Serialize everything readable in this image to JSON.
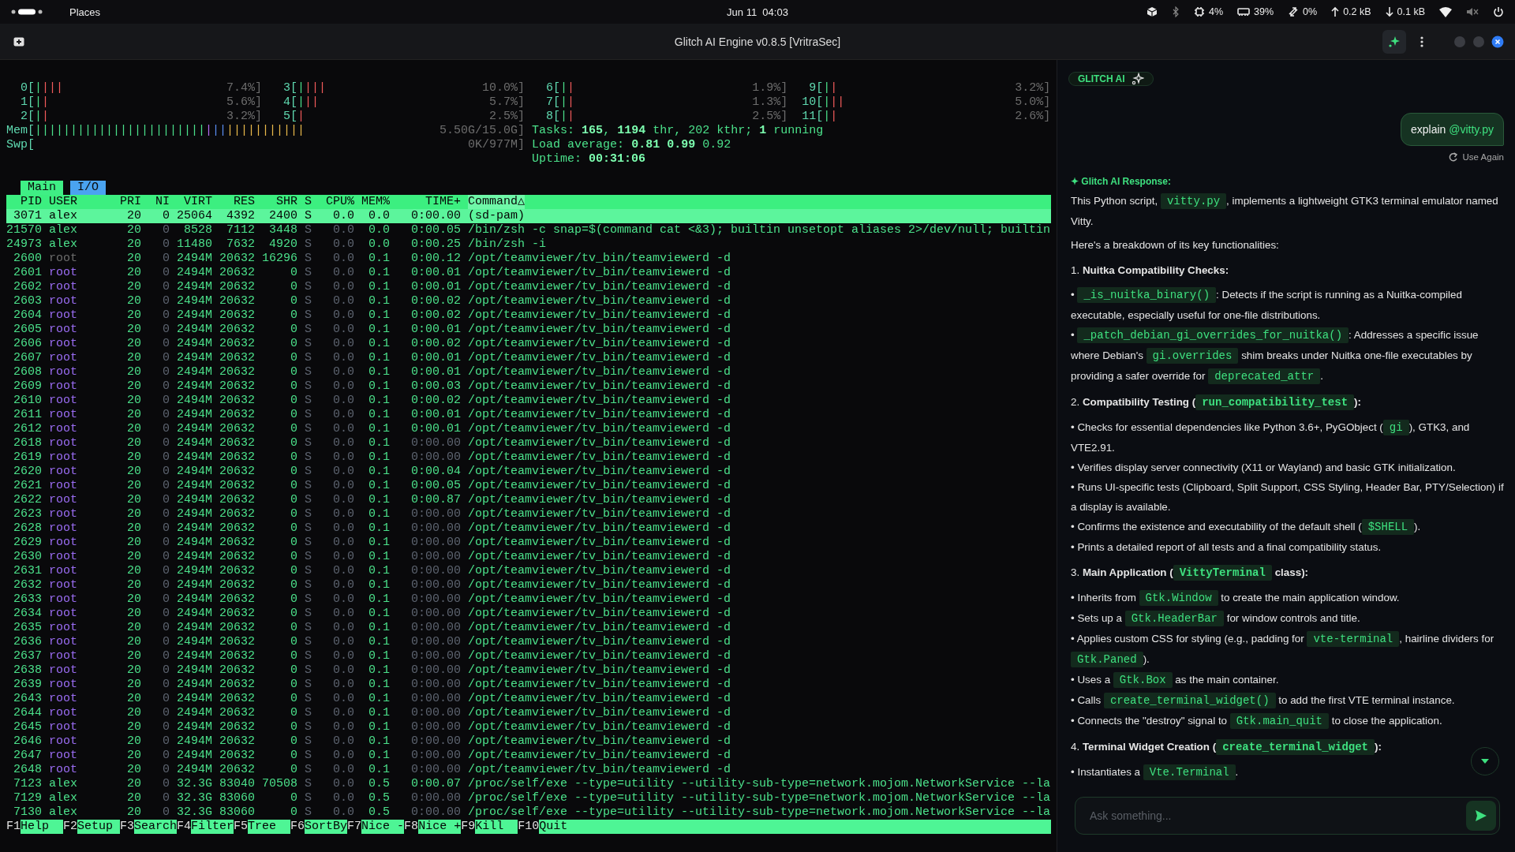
{
  "top_bar": {
    "places": "Places",
    "clock": "Jun 11  04:03",
    "indicators": [
      {
        "kind": "package"
      },
      {
        "kind": "bluetooth"
      },
      {
        "kind": "cpu",
        "text": "4%"
      },
      {
        "kind": "memory",
        "text": "39%"
      },
      {
        "kind": "transfer",
        "text": "0%"
      },
      {
        "kind": "upload",
        "text": "0.2 kB"
      },
      {
        "kind": "download",
        "text": "0.1 kB"
      },
      {
        "kind": "wifi"
      },
      {
        "kind": "muted"
      },
      {
        "kind": "power"
      }
    ]
  },
  "window": {
    "title": "Glitch AI Engine v0.8.5 [VritraSec]"
  },
  "htop": {
    "cpus": [
      {
        "label": "0[",
        "segments": [
          {
            "text": "|",
            "kind": "user"
          },
          {
            "text": "|||",
            "kind": "kernel"
          }
        ],
        "reading": "7.4%]"
      },
      {
        "label": "1[",
        "segments": [
          {
            "text": "|",
            "kind": "user"
          },
          {
            "text": "|",
            "kind": "kernel"
          }
        ],
        "reading": "5.6%]"
      },
      {
        "label": "2[",
        "segments": [
          {
            "text": "|",
            "kind": "user"
          },
          {
            "text": "|",
            "kind": "kernel"
          }
        ],
        "reading": "3.2%]"
      },
      {
        "label": "3[",
        "segments": [
          {
            "text": "|",
            "kind": "user"
          },
          {
            "text": "|||",
            "kind": "kernel"
          }
        ],
        "reading": "10.0%]"
      },
      {
        "label": "4[",
        "segments": [
          {
            "text": "|",
            "kind": "user"
          },
          {
            "text": "||",
            "kind": "kernel"
          }
        ],
        "reading": "5.7%]"
      },
      {
        "label": "5[",
        "segments": [
          {
            "text": "|",
            "kind": "kernel"
          }
        ],
        "reading": "2.5%]"
      },
      {
        "label": "6[",
        "segments": [
          {
            "text": "|",
            "kind": "user"
          },
          {
            "text": "|",
            "kind": "kernel"
          }
        ],
        "reading": "1.9%]"
      },
      {
        "label": "7[",
        "segments": [
          {
            "text": "|",
            "kind": "user"
          },
          {
            "text": "|",
            "kind": "kernel"
          }
        ],
        "reading": "1.3%]"
      },
      {
        "label": "8[",
        "segments": [
          {
            "text": "|",
            "kind": "user"
          },
          {
            "text": "|",
            "kind": "kernel"
          }
        ],
        "reading": "2.5%]"
      },
      {
        "label": "9[",
        "segments": [
          {
            "text": "|",
            "kind": "user"
          },
          {
            "text": "|",
            "kind": "kernel"
          }
        ],
        "reading": "3.2%]"
      },
      {
        "label": "10[",
        "segments": [
          {
            "text": "|",
            "kind": "user"
          },
          {
            "text": "||",
            "kind": "kernel"
          }
        ],
        "reading": "5.0%]"
      },
      {
        "label": "11[",
        "segments": [
          {
            "text": "|",
            "kind": "user"
          },
          {
            "text": "|",
            "kind": "kernel"
          }
        ],
        "reading": "2.6%]"
      }
    ],
    "memory": {
      "label": "Mem[",
      "segments": [
        {
          "text": "||||||||||||||||||||||||",
          "kind": "used"
        },
        {
          "text": "|",
          "kind": "shared"
        },
        {
          "text": "||",
          "kind": "buffers"
        },
        {
          "text": "|||||||||||",
          "kind": "cache"
        }
      ],
      "reading": "5.50G/15.0G]"
    },
    "swap": {
      "label": "Swp[",
      "reading": "0K/977M]"
    },
    "tasks": "Tasks: **165**, **1194** thr, 202 kthr; **1** running",
    "load": "Load average: **0.81** **0.99** 0.92",
    "uptime": "Uptime: **00:31:06**",
    "tabs": [
      {
        "label": "Main",
        "selected": true
      },
      {
        "label": "I/O",
        "selected": false
      }
    ],
    "columns": [
      {
        "label": "PID",
        "sorted": false
      },
      {
        "label": "USER",
        "sorted": false
      },
      {
        "label": "PRI",
        "sorted": false
      },
      {
        "label": "NI",
        "sorted": false
      },
      {
        "label": "VIRT",
        "sorted": false
      },
      {
        "label": "RES",
        "sorted": false
      },
      {
        "label": "SHR",
        "sorted": false
      },
      {
        "label": "S",
        "sorted": false
      },
      {
        "label": "CPU%",
        "sorted": false
      },
      {
        "label": "MEM%",
        "sorted": false
      },
      {
        "label": "TIME+",
        "sorted": false
      },
      {
        "label": "Command△",
        "sorted": true
      }
    ],
    "processes": [
      {
        "pid": "3071",
        "user": "alex",
        "pri": "20",
        "ni": "0",
        "virt": "25064",
        "res": "4392",
        "shr": "2400",
        "s": "S",
        "cpu": "0.0",
        "mem": "0.0",
        "time": "0:00.00",
        "time_dim": false,
        "command": "(sd-pam)",
        "selected": true
      },
      {
        "pid": "21570",
        "user": "alex",
        "color": "#4be08a",
        "pri": "20",
        "ni": "0",
        "virt": "8528",
        "res": "7112",
        "shr": "3448",
        "s": "S",
        "cpu": "0.0",
        "mem": "0.0",
        "time": "0:00.05",
        "time_dim": false,
        "command": "/bin/zsh -c snap=$(command cat <&3); builtin unsetopt aliases 2>/dev/null; builtin",
        "selected": false
      },
      {
        "pid": "24973",
        "user": "alex",
        "color": "#4be08a",
        "pri": "20",
        "ni": "0",
        "virt": "11480",
        "res": "7632",
        "shr": "4920",
        "s": "S",
        "cpu": "0.0",
        "mem": "0.0",
        "time": "0:00.25",
        "time_dim": false,
        "command": "/bin/zsh -i",
        "selected": false
      },
      {
        "pid": "2600",
        "user": "root",
        "color": "#6c6c6c",
        "pri": "20",
        "ni": "0",
        "virt": "2494M",
        "res": "20632",
        "shr": "16296",
        "s": "S",
        "cpu": "0.0",
        "mem": "0.1",
        "time": "0:00.12",
        "time_dim": false,
        "command": "/opt/teamviewer/tv_bin/teamviewerd -d",
        "selected": false
      },
      {
        "pid": "2601",
        "user": "root",
        "color": "#9a6cf2",
        "pri": "20",
        "ni": "0",
        "virt": "2494M",
        "res": "20632",
        "shr": "0",
        "s": "S",
        "cpu": "0.0",
        "mem": "0.1",
        "time": "0:00.01",
        "time_dim": false,
        "command": "/opt/teamviewer/tv_bin/teamviewerd -d",
        "selected": false
      },
      {
        "pid": "2602",
        "user": "root",
        "color": "#9a6cf2",
        "pri": "20",
        "ni": "0",
        "virt": "2494M",
        "res": "20632",
        "shr": "0",
        "s": "S",
        "cpu": "0.0",
        "mem": "0.1",
        "time": "0:00.01",
        "time_dim": false,
        "command": "/opt/teamviewer/tv_bin/teamviewerd -d",
        "selected": false
      },
      {
        "pid": "2603",
        "user": "root",
        "color": "#9a6cf2",
        "pri": "20",
        "ni": "0",
        "virt": "2494M",
        "res": "20632",
        "shr": "0",
        "s": "S",
        "cpu": "0.0",
        "mem": "0.1",
        "time": "0:00.02",
        "time_dim": false,
        "command": "/opt/teamviewer/tv_bin/teamviewerd -d",
        "selected": false
      },
      {
        "pid": "2604",
        "user": "root",
        "color": "#9a6cf2",
        "pri": "20",
        "ni": "0",
        "virt": "2494M",
        "res": "20632",
        "shr": "0",
        "s": "S",
        "cpu": "0.0",
        "mem": "0.1",
        "time": "0:00.02",
        "time_dim": false,
        "command": "/opt/teamviewer/tv_bin/teamviewerd -d",
        "selected": false
      },
      {
        "pid": "2605",
        "user": "root",
        "color": "#9a6cf2",
        "pri": "20",
        "ni": "0",
        "virt": "2494M",
        "res": "20632",
        "shr": "0",
        "s": "S",
        "cpu": "0.0",
        "mem": "0.1",
        "time": "0:00.01",
        "time_dim": false,
        "command": "/opt/teamviewer/tv_bin/teamviewerd -d",
        "selected": false
      },
      {
        "pid": "2606",
        "user": "root",
        "color": "#9a6cf2",
        "pri": "20",
        "ni": "0",
        "virt": "2494M",
        "res": "20632",
        "shr": "0",
        "s": "S",
        "cpu": "0.0",
        "mem": "0.1",
        "time": "0:00.02",
        "time_dim": false,
        "command": "/opt/teamviewer/tv_bin/teamviewerd -d",
        "selected": false
      },
      {
        "pid": "2607",
        "user": "root",
        "color": "#9a6cf2",
        "pri": "20",
        "ni": "0",
        "virt": "2494M",
        "res": "20632",
        "shr": "0",
        "s": "S",
        "cpu": "0.0",
        "mem": "0.1",
        "time": "0:00.01",
        "time_dim": false,
        "command": "/opt/teamviewer/tv_bin/teamviewerd -d",
        "selected": false
      },
      {
        "pid": "2608",
        "user": "root",
        "color": "#9a6cf2",
        "pri": "20",
        "ni": "0",
        "virt": "2494M",
        "res": "20632",
        "shr": "0",
        "s": "S",
        "cpu": "0.0",
        "mem": "0.1",
        "time": "0:00.01",
        "time_dim": false,
        "command": "/opt/teamviewer/tv_bin/teamviewerd -d",
        "selected": false
      },
      {
        "pid": "2609",
        "user": "root",
        "color": "#9a6cf2",
        "pri": "20",
        "ni": "0",
        "virt": "2494M",
        "res": "20632",
        "shr": "0",
        "s": "S",
        "cpu": "0.0",
        "mem": "0.1",
        "time": "0:00.03",
        "time_dim": false,
        "command": "/opt/teamviewer/tv_bin/teamviewerd -d",
        "selected": false
      },
      {
        "pid": "2610",
        "user": "root",
        "color": "#9a6cf2",
        "pri": "20",
        "ni": "0",
        "virt": "2494M",
        "res": "20632",
        "shr": "0",
        "s": "S",
        "cpu": "0.0",
        "mem": "0.1",
        "time": "0:00.02",
        "time_dim": false,
        "command": "/opt/teamviewer/tv_bin/teamviewerd -d",
        "selected": false
      },
      {
        "pid": "2611",
        "user": "root",
        "color": "#9a6cf2",
        "pri": "20",
        "ni": "0",
        "virt": "2494M",
        "res": "20632",
        "shr": "0",
        "s": "S",
        "cpu": "0.0",
        "mem": "0.1",
        "time": "0:00.01",
        "time_dim": false,
        "command": "/opt/teamviewer/tv_bin/teamviewerd -d",
        "selected": false
      },
      {
        "pid": "2612",
        "user": "root",
        "color": "#9a6cf2",
        "pri": "20",
        "ni": "0",
        "virt": "2494M",
        "res": "20632",
        "shr": "0",
        "s": "S",
        "cpu": "0.0",
        "mem": "0.1",
        "time": "0:00.01",
        "time_dim": false,
        "command": "/opt/teamviewer/tv_bin/teamviewerd -d",
        "selected": false
      },
      {
        "pid": "2618",
        "user": "root",
        "color": "#9a6cf2",
        "pri": "20",
        "ni": "0",
        "virt": "2494M",
        "res": "20632",
        "shr": "0",
        "s": "S",
        "cpu": "0.0",
        "mem": "0.1",
        "time": "0:00.00",
        "time_dim": true,
        "command": "/opt/teamviewer/tv_bin/teamviewerd -d",
        "selected": false
      },
      {
        "pid": "2619",
        "user": "root",
        "color": "#9a6cf2",
        "pri": "20",
        "ni": "0",
        "virt": "2494M",
        "res": "20632",
        "shr": "0",
        "s": "S",
        "cpu": "0.0",
        "mem": "0.1",
        "time": "0:00.00",
        "time_dim": true,
        "command": "/opt/teamviewer/tv_bin/teamviewerd -d",
        "selected": false
      },
      {
        "pid": "2620",
        "user": "root",
        "color": "#9a6cf2",
        "pri": "20",
        "ni": "0",
        "virt": "2494M",
        "res": "20632",
        "shr": "0",
        "s": "S",
        "cpu": "0.0",
        "mem": "0.1",
        "time": "0:00.04",
        "time_dim": false,
        "command": "/opt/teamviewer/tv_bin/teamviewerd -d",
        "selected": false
      },
      {
        "pid": "2621",
        "user": "root",
        "color": "#9a6cf2",
        "pri": "20",
        "ni": "0",
        "virt": "2494M",
        "res": "20632",
        "shr": "0",
        "s": "S",
        "cpu": "0.0",
        "mem": "0.1",
        "time": "0:00.05",
        "time_dim": false,
        "command": "/opt/teamviewer/tv_bin/teamviewerd -d",
        "selected": false
      },
      {
        "pid": "2622",
        "user": "root",
        "color": "#9a6cf2",
        "pri": "20",
        "ni": "0",
        "virt": "2494M",
        "res": "20632",
        "shr": "0",
        "s": "S",
        "cpu": "0.0",
        "mem": "0.1",
        "time": "0:00.87",
        "time_dim": false,
        "command": "/opt/teamviewer/tv_bin/teamviewerd -d",
        "selected": false
      },
      {
        "pid": "2623",
        "user": "root",
        "color": "#9a6cf2",
        "pri": "20",
        "ni": "0",
        "virt": "2494M",
        "res": "20632",
        "shr": "0",
        "s": "S",
        "cpu": "0.0",
        "mem": "0.1",
        "time": "0:00.00",
        "time_dim": true,
        "command": "/opt/teamviewer/tv_bin/teamviewerd -d",
        "selected": false
      },
      {
        "pid": "2628",
        "user": "root",
        "color": "#9a6cf2",
        "pri": "20",
        "ni": "0",
        "virt": "2494M",
        "res": "20632",
        "shr": "0",
        "s": "S",
        "cpu": "0.0",
        "mem": "0.1",
        "time": "0:00.00",
        "time_dim": true,
        "command": "/opt/teamviewer/tv_bin/teamviewerd -d",
        "selected": false
      },
      {
        "pid": "2629",
        "user": "root",
        "color": "#9a6cf2",
        "pri": "20",
        "ni": "0",
        "virt": "2494M",
        "res": "20632",
        "shr": "0",
        "s": "S",
        "cpu": "0.0",
        "mem": "0.1",
        "time": "0:00.00",
        "time_dim": true,
        "command": "/opt/teamviewer/tv_bin/teamviewerd -d",
        "selected": false
      },
      {
        "pid": "2630",
        "user": "root",
        "color": "#9a6cf2",
        "pri": "20",
        "ni": "0",
        "virt": "2494M",
        "res": "20632",
        "shr": "0",
        "s": "S",
        "cpu": "0.0",
        "mem": "0.1",
        "time": "0:00.00",
        "time_dim": true,
        "command": "/opt/teamviewer/tv_bin/teamviewerd -d",
        "selected": false
      },
      {
        "pid": "2631",
        "user": "root",
        "color": "#9a6cf2",
        "pri": "20",
        "ni": "0",
        "virt": "2494M",
        "res": "20632",
        "shr": "0",
        "s": "S",
        "cpu": "0.0",
        "mem": "0.1",
        "time": "0:00.00",
        "time_dim": true,
        "command": "/opt/teamviewer/tv_bin/teamviewerd -d",
        "selected": false
      },
      {
        "pid": "2632",
        "user": "root",
        "color": "#9a6cf2",
        "pri": "20",
        "ni": "0",
        "virt": "2494M",
        "res": "20632",
        "shr": "0",
        "s": "S",
        "cpu": "0.0",
        "mem": "0.1",
        "time": "0:00.00",
        "time_dim": true,
        "command": "/opt/teamviewer/tv_bin/teamviewerd -d",
        "selected": false
      },
      {
        "pid": "2633",
        "user": "root",
        "color": "#9a6cf2",
        "pri": "20",
        "ni": "0",
        "virt": "2494M",
        "res": "20632",
        "shr": "0",
        "s": "S",
        "cpu": "0.0",
        "mem": "0.1",
        "time": "0:00.00",
        "time_dim": true,
        "command": "/opt/teamviewer/tv_bin/teamviewerd -d",
        "selected": false
      },
      {
        "pid": "2634",
        "user": "root",
        "color": "#9a6cf2",
        "pri": "20",
        "ni": "0",
        "virt": "2494M",
        "res": "20632",
        "shr": "0",
        "s": "S",
        "cpu": "0.0",
        "mem": "0.1",
        "time": "0:00.00",
        "time_dim": true,
        "command": "/opt/teamviewer/tv_bin/teamviewerd -d",
        "selected": false
      },
      {
        "pid": "2635",
        "user": "root",
        "color": "#9a6cf2",
        "pri": "20",
        "ni": "0",
        "virt": "2494M",
        "res": "20632",
        "shr": "0",
        "s": "S",
        "cpu": "0.0",
        "mem": "0.1",
        "time": "0:00.00",
        "time_dim": true,
        "command": "/opt/teamviewer/tv_bin/teamviewerd -d",
        "selected": false
      },
      {
        "pid": "2636",
        "user": "root",
        "color": "#9a6cf2",
        "pri": "20",
        "ni": "0",
        "virt": "2494M",
        "res": "20632",
        "shr": "0",
        "s": "S",
        "cpu": "0.0",
        "mem": "0.1",
        "time": "0:00.00",
        "time_dim": true,
        "command": "/opt/teamviewer/tv_bin/teamviewerd -d",
        "selected": false
      },
      {
        "pid": "2637",
        "user": "root",
        "color": "#9a6cf2",
        "pri": "20",
        "ni": "0",
        "virt": "2494M",
        "res": "20632",
        "shr": "0",
        "s": "S",
        "cpu": "0.0",
        "mem": "0.1",
        "time": "0:00.00",
        "time_dim": true,
        "command": "/opt/teamviewer/tv_bin/teamviewerd -d",
        "selected": false
      },
      {
        "pid": "2638",
        "user": "root",
        "color": "#9a6cf2",
        "pri": "20",
        "ni": "0",
        "virt": "2494M",
        "res": "20632",
        "shr": "0",
        "s": "S",
        "cpu": "0.0",
        "mem": "0.1",
        "time": "0:00.00",
        "time_dim": true,
        "command": "/opt/teamviewer/tv_bin/teamviewerd -d",
        "selected": false
      },
      {
        "pid": "2639",
        "user": "root",
        "color": "#9a6cf2",
        "pri": "20",
        "ni": "0",
        "virt": "2494M",
        "res": "20632",
        "shr": "0",
        "s": "S",
        "cpu": "0.0",
        "mem": "0.1",
        "time": "0:00.00",
        "time_dim": true,
        "command": "/opt/teamviewer/tv_bin/teamviewerd -d",
        "selected": false
      },
      {
        "pid": "2643",
        "user": "root",
        "color": "#9a6cf2",
        "pri": "20",
        "ni": "0",
        "virt": "2494M",
        "res": "20632",
        "shr": "0",
        "s": "S",
        "cpu": "0.0",
        "mem": "0.1",
        "time": "0:00.00",
        "time_dim": true,
        "command": "/opt/teamviewer/tv_bin/teamviewerd -d",
        "selected": false
      },
      {
        "pid": "2644",
        "user": "root",
        "color": "#9a6cf2",
        "pri": "20",
        "ni": "0",
        "virt": "2494M",
        "res": "20632",
        "shr": "0",
        "s": "S",
        "cpu": "0.0",
        "mem": "0.1",
        "time": "0:00.00",
        "time_dim": true,
        "command": "/opt/teamviewer/tv_bin/teamviewerd -d",
        "selected": false
      },
      {
        "pid": "2645",
        "user": "root",
        "color": "#9a6cf2",
        "pri": "20",
        "ni": "0",
        "virt": "2494M",
        "res": "20632",
        "shr": "0",
        "s": "S",
        "cpu": "0.0",
        "mem": "0.1",
        "time": "0:00.00",
        "time_dim": true,
        "command": "/opt/teamviewer/tv_bin/teamviewerd -d",
        "selected": false
      },
      {
        "pid": "2646",
        "user": "root",
        "color": "#9a6cf2",
        "pri": "20",
        "ni": "0",
        "virt": "2494M",
        "res": "20632",
        "shr": "0",
        "s": "S",
        "cpu": "0.0",
        "mem": "0.1",
        "time": "0:00.00",
        "time_dim": true,
        "command": "/opt/teamviewer/tv_bin/teamviewerd -d",
        "selected": false
      },
      {
        "pid": "2647",
        "user": "root",
        "color": "#9a6cf2",
        "pri": "20",
        "ni": "0",
        "virt": "2494M",
        "res": "20632",
        "shr": "0",
        "s": "S",
        "cpu": "0.0",
        "mem": "0.1",
        "time": "0:00.00",
        "time_dim": true,
        "command": "/opt/teamviewer/tv_bin/teamviewerd -d",
        "selected": false
      },
      {
        "pid": "2648",
        "user": "root",
        "color": "#9a6cf2",
        "pri": "20",
        "ni": "0",
        "virt": "2494M",
        "res": "20632",
        "shr": "0",
        "s": "S",
        "cpu": "0.0",
        "mem": "0.1",
        "time": "0:00.00",
        "time_dim": true,
        "command": "/opt/teamviewer/tv_bin/teamviewerd -d",
        "selected": false
      },
      {
        "pid": "7123",
        "user": "alex",
        "color": "#4be08a",
        "pri": "20",
        "ni": "0",
        "virt": "32.3G",
        "res": "83040",
        "shr": "70508",
        "s": "S",
        "cpu": "0.0",
        "mem": "0.5",
        "time": "0:00.07",
        "time_dim": false,
        "command": "/proc/self/exe --type=utility --utility-sub-type=network.mojom.NetworkService --la",
        "selected": false
      },
      {
        "pid": "7129",
        "user": "alex",
        "color": "#4be08a",
        "pri": "20",
        "ni": "0",
        "virt": "32.3G",
        "res": "83060",
        "shr": "0",
        "s": "S",
        "cpu": "0.0",
        "mem": "0.5",
        "time": "0:00.00",
        "time_dim": true,
        "command": "/proc/self/exe --type=utility --utility-sub-type=network.mojom.NetworkService --la",
        "selected": false
      },
      {
        "pid": "7130",
        "user": "alex",
        "color": "#4be08a",
        "pri": "20",
        "ni": "0",
        "virt": "32.3G",
        "res": "83060",
        "shr": "0",
        "s": "S",
        "cpu": "0.0",
        "mem": "0.5",
        "time": "0:00.00",
        "time_dim": true,
        "command": "/proc/self/exe --type=utility --utility-sub-type=network.mojom.NetworkService --la",
        "selected": false
      }
    ],
    "function_keys": [
      {
        "key": "F1",
        "label": "Help"
      },
      {
        "key": "F2",
        "label": "Setup"
      },
      {
        "key": "F3",
        "label": "Search"
      },
      {
        "key": "F4",
        "label": "Filter"
      },
      {
        "key": "F5",
        "label": "Tree"
      },
      {
        "key": "F6",
        "label": "SortBy"
      },
      {
        "key": "F7",
        "label": "Nice -"
      },
      {
        "key": "F8",
        "label": "Nice +"
      },
      {
        "key": "F9",
        "label": "Kill"
      },
      {
        "key": "F10",
        "label": "Quit"
      }
    ]
  },
  "chat": {
    "badge": "GLITCH AI",
    "user_message": [
      {
        "text": "explain ",
        "mention": false
      },
      {
        "text": "@vitty.py",
        "mention": true
      }
    ],
    "use_again": "Use Again",
    "response_label": "✦ Glitch AI Response:",
    "blocks": [
      {
        "kind": "para",
        "parts": [
          {
            "text": "This Python script, "
          },
          {
            "text": "vitty.py",
            "code": true
          },
          {
            "text": ", implements a lightweight GTK3 terminal emulator named Vitty."
          }
        ]
      },
      {
        "kind": "para",
        "parts": [
          {
            "text": "Here's a breakdown of its key functionalities:"
          }
        ]
      },
      {
        "kind": "heading",
        "number": "1.",
        "parts": [
          {
            "text": "Nuitka Compatibility Checks:"
          }
        ]
      },
      {
        "kind": "bullet",
        "parts": [
          {
            "text": "• "
          },
          {
            "text": "_is_nuitka_binary()",
            "code": true
          },
          {
            "text": ": Detects if the script is running as a Nuitka-compiled executable, especially useful for one-file distributions."
          }
        ]
      },
      {
        "kind": "bullet",
        "parts": [
          {
            "text": "• "
          },
          {
            "text": "_patch_debian_gi_overrides_for_nuitka()",
            "code": true
          },
          {
            "text": ": Addresses a specific issue where Debian's "
          },
          {
            "text": "gi.overrides",
            "code": true
          },
          {
            "text": " shim breaks under Nuitka one-file executables by providing a safer override for "
          },
          {
            "text": "deprecated_attr",
            "code": true
          },
          {
            "text": "."
          }
        ]
      },
      {
        "kind": "heading",
        "number": "2.",
        "parts": [
          {
            "text": "Compatibility Testing ("
          },
          {
            "text": "run_compatibility_test",
            "code": true
          },
          {
            "text": "):"
          }
        ]
      },
      {
        "kind": "bullet",
        "parts": [
          {
            "text": "• Checks for essential dependencies like Python 3.6+, PyGObject ("
          },
          {
            "text": "gi",
            "code": true
          },
          {
            "text": "), GTK3, and VTE2.91."
          }
        ]
      },
      {
        "kind": "bullet",
        "parts": [
          {
            "text": "• Verifies display server connectivity (X11 or Wayland) and basic GTK initialization."
          }
        ]
      },
      {
        "kind": "bullet",
        "parts": [
          {
            "text": "• Runs UI-specific tests (Clipboard, Split Support, CSS Styling, Header Bar, PTY/Selection) if a display is available."
          }
        ]
      },
      {
        "kind": "bullet",
        "parts": [
          {
            "text": "• Confirms the existence and executability of the default shell ("
          },
          {
            "text": "$SHELL",
            "code": true
          },
          {
            "text": ")."
          }
        ]
      },
      {
        "kind": "bullet",
        "parts": [
          {
            "text": "• Prints a detailed report of all tests and a final compatibility status."
          }
        ]
      },
      {
        "kind": "heading",
        "number": "3.",
        "parts": [
          {
            "text": "Main Application ("
          },
          {
            "text": "VittyTerminal",
            "code": true
          },
          {
            "text": " class):"
          }
        ]
      },
      {
        "kind": "bullet",
        "parts": [
          {
            "text": "• Inherits from "
          },
          {
            "text": "Gtk.Window",
            "code": true
          },
          {
            "text": " to create the main application window."
          }
        ]
      },
      {
        "kind": "bullet",
        "parts": [
          {
            "text": "• Sets up a "
          },
          {
            "text": "Gtk.HeaderBar",
            "code": true
          },
          {
            "text": " for window controls and title."
          }
        ]
      },
      {
        "kind": "bullet",
        "parts": [
          {
            "text": "• Applies custom CSS for styling (e.g., padding for "
          },
          {
            "text": "vte-terminal",
            "code": true
          },
          {
            "text": ", hairline dividers for "
          },
          {
            "text": "Gtk.Paned",
            "code": true
          },
          {
            "text": ")."
          }
        ]
      },
      {
        "kind": "bullet",
        "parts": [
          {
            "text": "• Uses a "
          },
          {
            "text": "Gtk.Box",
            "code": true
          },
          {
            "text": " as the main container."
          }
        ]
      },
      {
        "kind": "bullet",
        "parts": [
          {
            "text": "• Calls "
          },
          {
            "text": "create_terminal_widget()",
            "code": true
          },
          {
            "text": " to add the first VTE terminal instance."
          }
        ]
      },
      {
        "kind": "bullet",
        "parts": [
          {
            "text": "• Connects the \"destroy\" signal to "
          },
          {
            "text": "Gtk.main_quit",
            "code": true
          },
          {
            "text": " to close the application."
          }
        ]
      },
      {
        "kind": "heading",
        "number": "4.",
        "parts": [
          {
            "text": "Terminal Widget Creation ("
          },
          {
            "text": "create_terminal_widget",
            "code": true
          },
          {
            "text": "):"
          }
        ]
      },
      {
        "kind": "bullet",
        "parts": [
          {
            "text": "• Instantiates a "
          },
          {
            "text": "Vte.Terminal",
            "code": true
          },
          {
            "text": "."
          }
        ]
      }
    ],
    "input": {
      "placeholder": "Ask something..."
    }
  }
}
